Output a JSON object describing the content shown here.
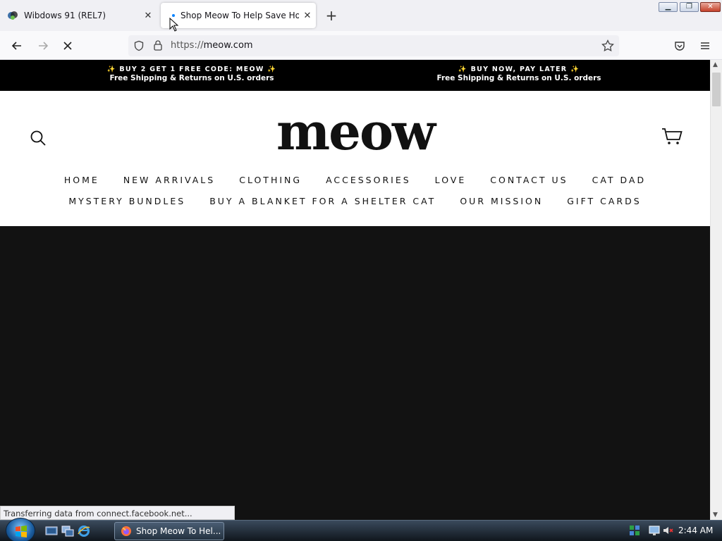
{
  "browser": {
    "tabs": [
      {
        "title": "Wibdows 91 (REL7)",
        "active": false
      },
      {
        "title": "Shop Meow To Help Save Hon",
        "active": true
      }
    ],
    "window_controls": {
      "minimize": "▁",
      "maximize": "❐",
      "close": "✕"
    },
    "url": {
      "scheme": "https://",
      "host": "meow.com"
    },
    "status_text": "Transferring data from connect.facebook.net..."
  },
  "page": {
    "announcements": [
      {
        "line1": "BUY 2 GET 1 FREE CODE: MEOW",
        "line2": "Free Shipping & Returns on U.S. orders"
      },
      {
        "line1": "BUY NOW, PAY LATER",
        "line2": "Free Shipping & Returns on U.S. orders"
      }
    ],
    "logo": "meow",
    "nav_row_1": [
      "HOME",
      "NEW ARRIVALS",
      "CLOTHING",
      "ACCESSORIES",
      "LOVE",
      "CONTACT US",
      "CAT DAD"
    ],
    "nav_row_2": [
      "MYSTERY BUNDLES",
      "BUY A BLANKET FOR A SHELTER CAT",
      "OUR MISSION",
      "GIFT CARDS"
    ],
    "hero_color": "#121212"
  },
  "taskbar": {
    "task_button": "Shop Meow To Hel...",
    "clock": "2:44 AM"
  },
  "icons": [
    "back-icon",
    "forward-icon",
    "stop-icon",
    "shield-icon",
    "lock-icon",
    "star-icon",
    "pocket-icon",
    "menu-icon",
    "search-icon",
    "cart-icon",
    "firefox-icon",
    "windows-start-icon"
  ],
  "colors": {
    "accent": "#0a84ff",
    "announce_bg": "#000000",
    "spark": "#f5c542"
  }
}
